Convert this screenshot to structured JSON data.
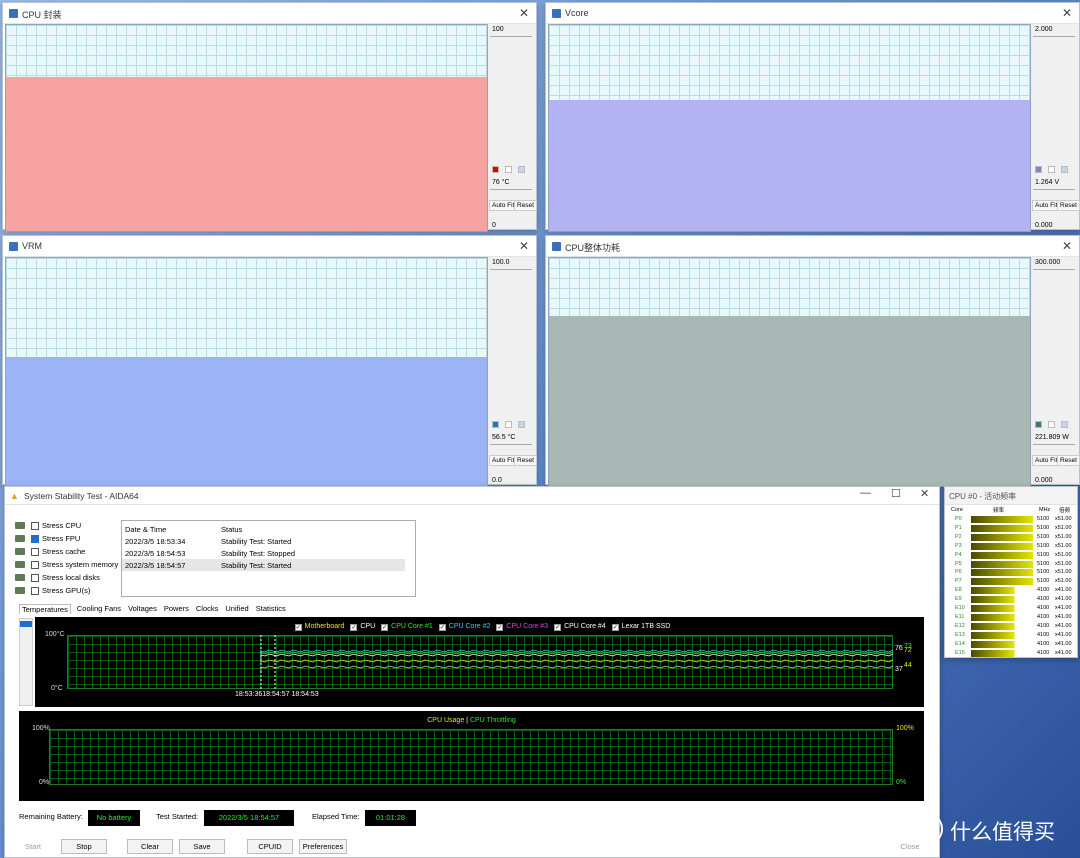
{
  "monitors": [
    {
      "title": "CPU 封装",
      "scale_top": "100",
      "reading": "76 °C",
      "scale_bottom": "0",
      "fill_color": "#f7a1a1",
      "swatch": "#e00000",
      "fill_level": 0.74
    },
    {
      "title": "Vcore",
      "scale_top": "2.000",
      "reading": "1.264 V",
      "scale_bottom": "0.000",
      "fill_color": "#b3b3f3",
      "swatch": "#8d7dc6",
      "fill_level": 0.63
    },
    {
      "title": "VRM",
      "scale_top": "100.0",
      "reading": "56.5 °C",
      "scale_bottom": "0.0",
      "fill_color": "#9cb3f6",
      "swatch": "#1e7ab8",
      "fill_level": 0.56
    },
    {
      "title": "CPU整体功耗",
      "scale_top": "300.000",
      "reading": "221.809 W",
      "scale_bottom": "0.000",
      "fill_color": "#a8b8b5",
      "swatch": "#3a7a78",
      "fill_level": 0.74
    }
  ],
  "monitor_buttons": {
    "autofit": "Auto Fit",
    "reset": "Reset"
  },
  "aida": {
    "title": "System Stability Test - AIDA64",
    "stress": [
      {
        "label": "Stress CPU",
        "checked": false
      },
      {
        "label": "Stress FPU",
        "checked": true
      },
      {
        "label": "Stress cache",
        "checked": false
      },
      {
        "label": "Stress system memory",
        "checked": false
      },
      {
        "label": "Stress local disks",
        "checked": false
      },
      {
        "label": "Stress GPU(s)",
        "checked": false
      }
    ],
    "log_headers": [
      "Date & Time",
      "Status"
    ],
    "log_rows": [
      [
        "2022/3/5 18:53:34",
        "Stability Test: Started"
      ],
      [
        "2022/3/5 18:54:53",
        "Stability Test: Stopped"
      ],
      [
        "2022/3/5 18:54:57",
        "Stability Test: Started"
      ]
    ],
    "tabs": [
      "Temperatures",
      "Cooling Fans",
      "Voltages",
      "Powers",
      "Clocks",
      "Unified",
      "Statistics"
    ],
    "temp_legend": [
      {
        "label": "Motherboard",
        "color": "#e8e800"
      },
      {
        "label": "CPU",
        "color": "#ffffff"
      },
      {
        "label": "CPU Core #1",
        "color": "#2fe62f"
      },
      {
        "label": "CPU Core #2",
        "color": "#39c9ff"
      },
      {
        "label": "CPU Core #3",
        "color": "#e040e0"
      },
      {
        "label": "CPU Core #4",
        "color": "#ffffff"
      },
      {
        "label": "Lexar 1TB SSD",
        "color": "#ffffff"
      }
    ],
    "temp_top": "100°C",
    "temp_bottom": "0°C",
    "temp_time": "18:53:3618:54:57 18:54:53",
    "temp_vals": {
      "v76": "76",
      "v72": "72",
      "v73": "73",
      "v44": "44",
      "v37": "37"
    },
    "usage_legend": {
      "a": "CPU Usage",
      "sep": "|",
      "b": "CPU Throttling"
    },
    "usage_top": "100%",
    "usage_bottom": "0%",
    "usage_top_r": "100%",
    "usage_bottom_r": "0%",
    "status": {
      "battery_label": "Remaining Battery:",
      "battery": "No battery",
      "started_label": "Test Started:",
      "started": "2022/3/5 18:54:57",
      "elapsed_label": "Elapsed Time:",
      "elapsed": "01:01:28"
    },
    "buttons": {
      "start": "Start",
      "stop": "Stop",
      "clear": "Clear",
      "save": "Save",
      "cpuid": "CPUID",
      "prefs": "Preferences",
      "close": "Close"
    }
  },
  "freq": {
    "title": "CPU #0 - 活动频率",
    "headers": {
      "core": "Core",
      "freq": "频率",
      "mhz": "MHz",
      "mult": "倍频"
    },
    "rows": [
      {
        "core": "P0",
        "mhz": "5100",
        "mult": "x51.00",
        "full": true
      },
      {
        "core": "P1",
        "mhz": "5100",
        "mult": "x51.00",
        "full": true
      },
      {
        "core": "P2",
        "mhz": "5100",
        "mult": "x51.00",
        "full": true
      },
      {
        "core": "P3",
        "mhz": "5100",
        "mult": "x51.00",
        "full": true
      },
      {
        "core": "P4",
        "mhz": "5100",
        "mult": "x51.00",
        "full": true
      },
      {
        "core": "P5",
        "mhz": "5100",
        "mult": "x51.00",
        "full": true
      },
      {
        "core": "P6",
        "mhz": "5100",
        "mult": "x51.00",
        "full": true
      },
      {
        "core": "P7",
        "mhz": "5100",
        "mult": "x51.00",
        "full": true
      },
      {
        "core": "E8",
        "mhz": "4100",
        "mult": "x41.00",
        "full": false
      },
      {
        "core": "E9",
        "mhz": "4100",
        "mult": "x41.00",
        "full": false
      },
      {
        "core": "E10",
        "mhz": "4100",
        "mult": "x41.00",
        "full": false
      },
      {
        "core": "E11",
        "mhz": "4100",
        "mult": "x41.00",
        "full": false
      },
      {
        "core": "E12",
        "mhz": "4100",
        "mult": "x41.00",
        "full": false
      },
      {
        "core": "E13",
        "mhz": "4100",
        "mult": "x41.00",
        "full": false
      },
      {
        "core": "E14",
        "mhz": "4100",
        "mult": "x41.00",
        "full": false
      },
      {
        "core": "E15",
        "mhz": "4100",
        "mult": "x41.00",
        "full": false
      }
    ]
  },
  "watermark": "什么值得买"
}
